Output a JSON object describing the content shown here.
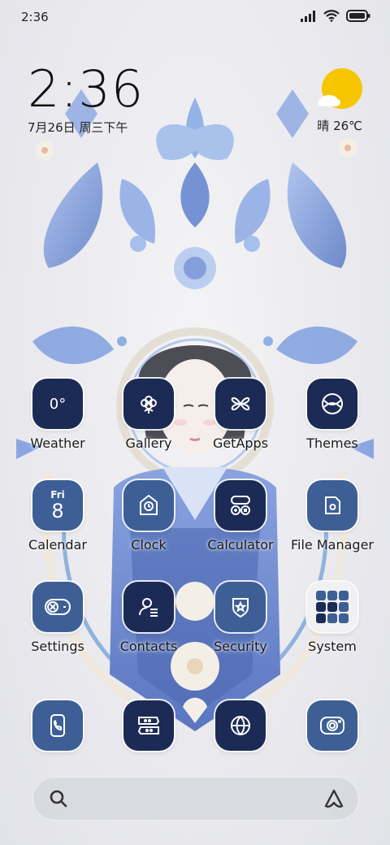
{
  "status_bar": {
    "time": "2:36",
    "icons": [
      "signal-icon",
      "wifi-icon",
      "battery-icon"
    ]
  },
  "clock_widget": {
    "time": "2:36",
    "date": "7月26日 周三下午"
  },
  "weather_widget": {
    "icon": "sunny-cloud-icon",
    "text": "晴 26℃"
  },
  "apps": [
    {
      "label": "Weather",
      "icon": "weather-icon",
      "style": "dark",
      "text": "0°"
    },
    {
      "label": "Gallery",
      "icon": "flower-icon",
      "style": "dark"
    },
    {
      "label": "GetApps",
      "icon": "petals-icon",
      "style": "dark"
    },
    {
      "label": "Themes",
      "icon": "themes-icon",
      "style": "dark"
    },
    {
      "label": "Calendar",
      "icon": "calendar-icon",
      "style": "mid",
      "day": "Fri",
      "num": "8"
    },
    {
      "label": "Clock",
      "icon": "clock-icon",
      "style": "mid"
    },
    {
      "label": "Calculator",
      "icon": "calculator-icon",
      "style": "dark"
    },
    {
      "label": "File Manager",
      "icon": "folder-icon",
      "style": "mid"
    },
    {
      "label": "Settings",
      "icon": "toggle-icon",
      "style": "mid"
    },
    {
      "label": "Contacts",
      "icon": "contact-icon",
      "style": "dark"
    },
    {
      "label": "Security",
      "icon": "shield-icon",
      "style": "mid"
    },
    {
      "label": "System",
      "icon": "folder-grid-icon",
      "style": "light"
    }
  ],
  "dock": [
    {
      "icon": "phone-icon",
      "style": "mid"
    },
    {
      "icon": "message-icon",
      "style": "dark"
    },
    {
      "icon": "browser-icon",
      "style": "dark"
    },
    {
      "icon": "camera-icon",
      "style": "mid"
    }
  ],
  "search_bar": {
    "left_icon": "search-icon",
    "right_icon": "assistant-icon"
  },
  "colors": {
    "icon_dark": "#1c2b55",
    "icon_mid": "#3d5f95",
    "wallpaper_blue": "#7d9ad6",
    "sun_yellow": "#f7c600"
  }
}
